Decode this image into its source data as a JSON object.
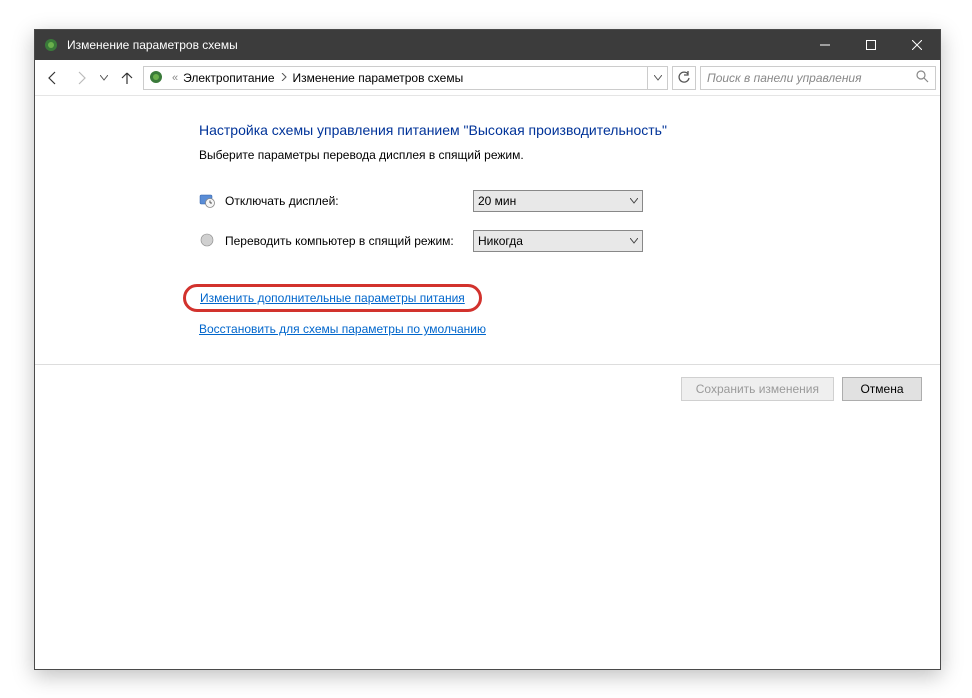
{
  "titlebar": {
    "title": "Изменение параметров схемы"
  },
  "breadcrumb": {
    "laquo": "«",
    "item1": "Электропитание",
    "item2": "Изменение параметров схемы"
  },
  "search": {
    "placeholder": "Поиск в панели управления"
  },
  "content": {
    "heading": "Настройка схемы управления питанием \"Высокая производительность\"",
    "subtext": "Выберите параметры перевода дисплея в спящий режим.",
    "display_off_label": "Отключать дисплей:",
    "display_off_value": "20 мин",
    "sleep_label": "Переводить компьютер в спящий режим:",
    "sleep_value": "Никогда",
    "link_advanced": "Изменить дополнительные параметры питания",
    "link_restore": "Восстановить для схемы параметры по умолчанию"
  },
  "buttons": {
    "save": "Сохранить изменения",
    "cancel": "Отмена"
  }
}
